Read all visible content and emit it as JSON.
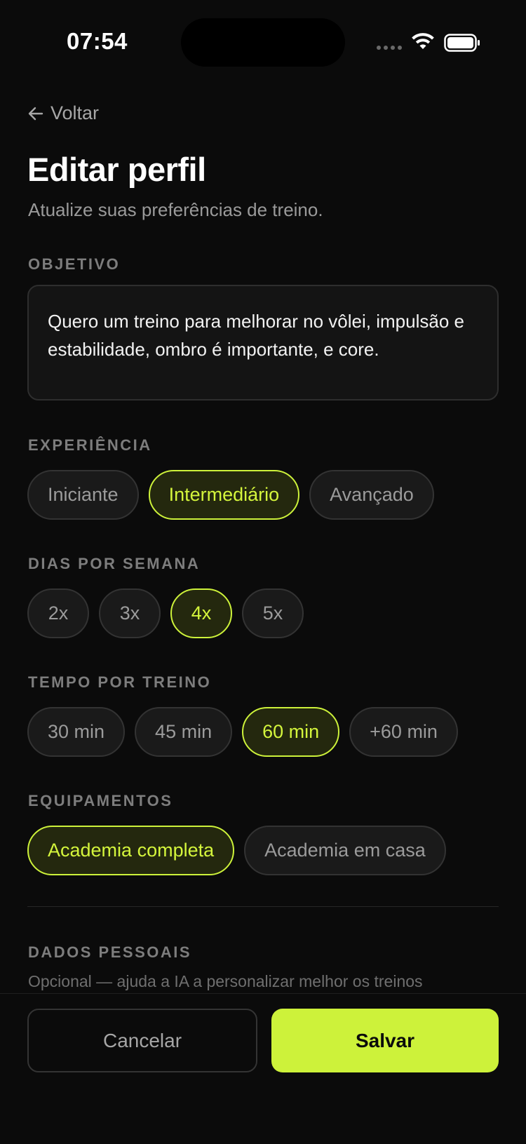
{
  "status_bar": {
    "time": "07:54"
  },
  "header": {
    "back_label": "Voltar",
    "title": "Editar perfil",
    "subtitle": "Atualize suas preferências de treino."
  },
  "goal": {
    "label": "OBJETIVO",
    "text": "Quero um treino para melhorar no vôlei, impulsão e estabilidade, ombro é importante, e core."
  },
  "experience": {
    "label": "EXPERIÊNCIA",
    "options": [
      "Iniciante",
      "Intermediário",
      "Avançado"
    ],
    "selected": "Intermediário"
  },
  "days": {
    "label": "DIAS POR SEMANA",
    "options": [
      "2x",
      "3x",
      "4x",
      "5x"
    ],
    "selected": "4x"
  },
  "duration": {
    "label": "TEMPO POR TREINO",
    "options": [
      "30 min",
      "45 min",
      "60 min",
      "+60 min"
    ],
    "selected": "60 min"
  },
  "equipment": {
    "label": "EQUIPAMENTOS",
    "options": [
      "Academia completa",
      "Academia em casa"
    ],
    "selected": "Academia completa"
  },
  "personal": {
    "label": "DADOS PESSOAIS",
    "subtitle": "Opcional — ajuda a IA a personalizar melhor os treinos"
  },
  "actions": {
    "cancel_label": "Cancelar",
    "save_label": "Salvar"
  },
  "colors": {
    "background": "#0b0b0b",
    "accent": "#cdf23a",
    "chip_bg": "#1a1a1a",
    "selected_chip_bg": "#24280e"
  },
  "icons": {
    "back": "arrow-left-icon",
    "wifi": "wifi-icon",
    "battery": "battery-icon",
    "signal": "cellular-signal-icon"
  }
}
